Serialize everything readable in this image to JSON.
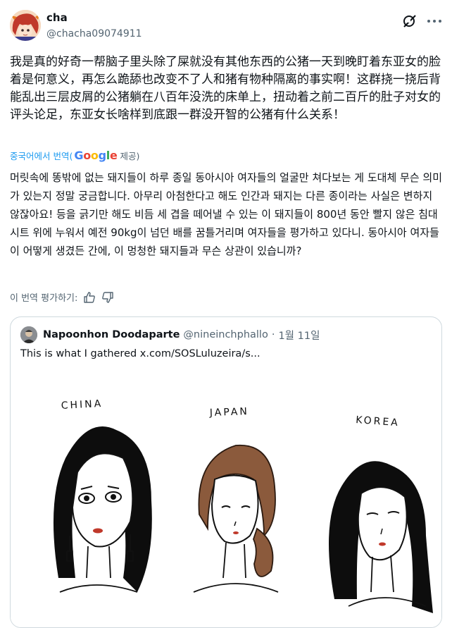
{
  "author": {
    "name": "cha",
    "handle": "@chacha09074911"
  },
  "post": {
    "text_zh": "我是真的好奇一帮脑子里头除了屎就没有其他东西的公猪一天到晚盯着东亚女的脸着是何意义，再怎么跪舔也改变不了人和猪有物种隔离的事实啊！这群挠一挠后背能乱出三层皮屑的公猪躺在八百年没洗的床单上，扭动着之前二百斤的肚子对女的评头论足，东亚女长啥样到底跟一群没开智的公猪有什么关系！",
    "translate_source": "중국어에서 번역(",
    "translate_provider": "Google",
    "translate_suffix": "제공)",
    "text_ko": "머릿속에 똥밖에 없는 돼지들이 하루 종일 동아시아 여자들의 얼굴만 쳐다보는 게 도대체 무슨 의미가 있는지 정말 궁금합니다. 아무리 아첨한다고 해도 인간과 돼지는 다른 종이라는 사실은 변하지 않잖아요! 등을 긁기만 해도 비듬 세 겹을 떼어낼 수 있는 이 돼지들이 800년 동안 빨지 않은 침대 시트 위에 누워서 예전 90kg이 넘던 배를 꿈틀거리며 여자들을 평가하고 있다니. 동아시아 여자들이 어떻게 생겼든 간에, 이 멍청한 돼지들과 무슨 상관이 있습니까?",
    "rate_translation": "이 번역 평가하기:"
  },
  "quote": {
    "name": "Napoonhon Doodaparte",
    "handle": "@nineinchphallo",
    "separator": "·",
    "date": "1월 11일",
    "text": "This is what I gathered  x.com/SOSLuluzeira/s...",
    "drawing_labels": [
      "CHINA",
      "JAPAN",
      "KOREA"
    ]
  },
  "colors": {
    "text": "#0f1419",
    "muted": "#536471",
    "link": "#1d9bf0",
    "border": "#cfd9de"
  },
  "icons": [
    "grok-icon",
    "more-icon",
    "thumbs-up-icon",
    "thumbs-down-icon"
  ]
}
